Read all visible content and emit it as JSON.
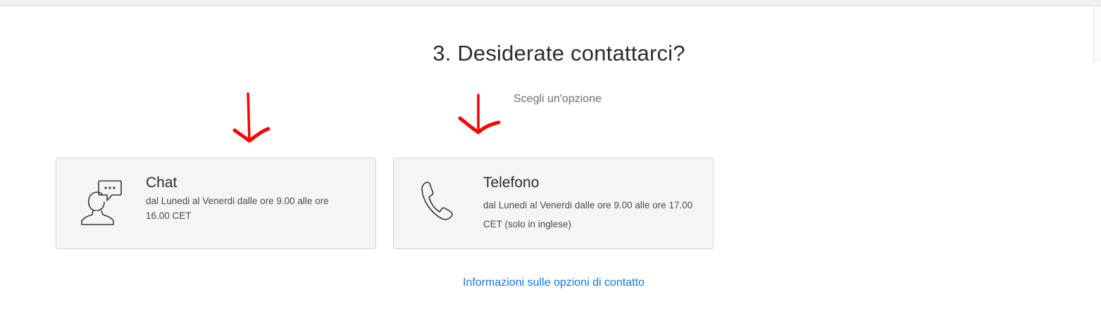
{
  "section": {
    "title": "3. Desiderate contattarci?",
    "subtitle": "Scegli un'opzione"
  },
  "options": [
    {
      "icon": "chat-person-icon",
      "title": "Chat",
      "description": "dal Lunedi al Venerdi dalle ore 9.00 alle ore 16.00 CET"
    },
    {
      "icon": "phone-icon",
      "title": "Telefono",
      "description": "dal Lunedi al Venerdi dalle ore 9.00 alle ore 17.00 CET (solo in inglese)"
    }
  ],
  "footer": {
    "link_label": "Informazioni sulle opzioni di contatto"
  },
  "colors": {
    "link": "#1473e6",
    "annotation_arrow": "#ff0000",
    "card_background": "#f5f5f5"
  }
}
